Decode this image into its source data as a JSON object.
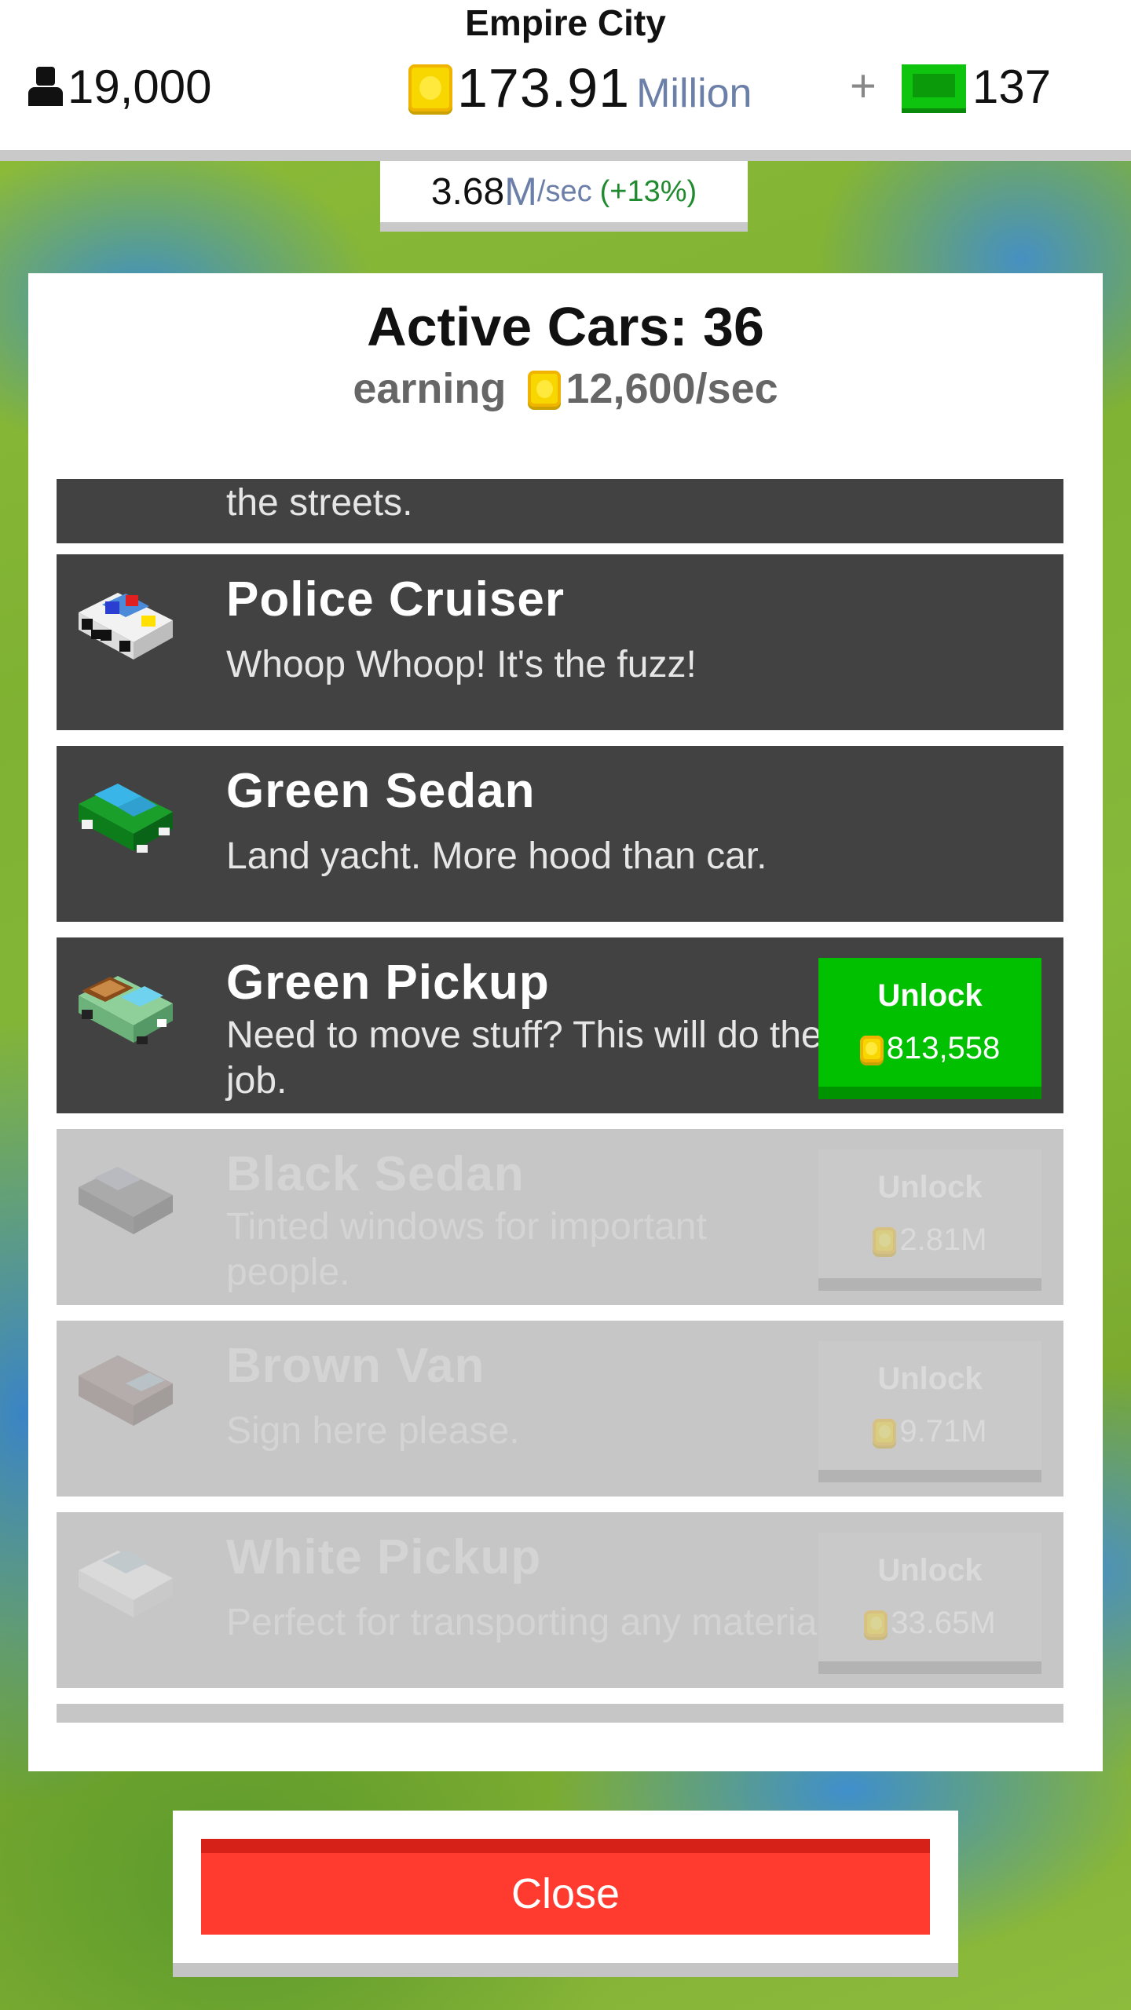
{
  "header": {
    "city_name": "Empire City",
    "population": "19,000",
    "money_amount": "173.91",
    "money_unit": "Million",
    "plus_label": "+",
    "cash": "137",
    "rate_value": "3.68",
    "rate_unit": "M",
    "rate_per": "/sec",
    "rate_pct": "(+13%)"
  },
  "panel": {
    "title": "Active Cars: 36",
    "earning_label": "earning",
    "earning_value": "12,600/sec"
  },
  "cars": [
    {
      "name": "",
      "desc": "the streets.",
      "state": "owned",
      "icon": "car-icon"
    },
    {
      "name": "Police Cruiser",
      "desc": "Whoop Whoop! It's the fuzz!",
      "state": "owned",
      "icon": "police-car-icon"
    },
    {
      "name": "Green Sedan",
      "desc": "Land yacht. More hood than car.",
      "state": "owned",
      "icon": "green-sedan-icon"
    },
    {
      "name": "Green Pickup",
      "desc": "Need to move stuff? This will do the job.",
      "state": "available",
      "unlock_label": "Unlock",
      "price": "813,558",
      "icon": "green-pickup-icon"
    },
    {
      "name": "Black Sedan",
      "desc": "Tinted windows for important people.",
      "state": "locked",
      "unlock_label": "Unlock",
      "price": "2.81M",
      "icon": "black-sedan-icon"
    },
    {
      "name": "Brown Van",
      "desc": "Sign here please.",
      "state": "locked",
      "unlock_label": "Unlock",
      "price": "9.71M",
      "icon": "brown-van-icon"
    },
    {
      "name": "White Pickup",
      "desc": "Perfect for transporting any material.",
      "state": "locked",
      "unlock_label": "Unlock",
      "price": "33.65M",
      "icon": "white-pickup-icon"
    }
  ],
  "colors": {
    "accent_green": "#00c000",
    "close_red": "#ff3b30",
    "row_dark": "#424242",
    "row_locked": "#c6c6c6"
  },
  "close_label": "Close"
}
